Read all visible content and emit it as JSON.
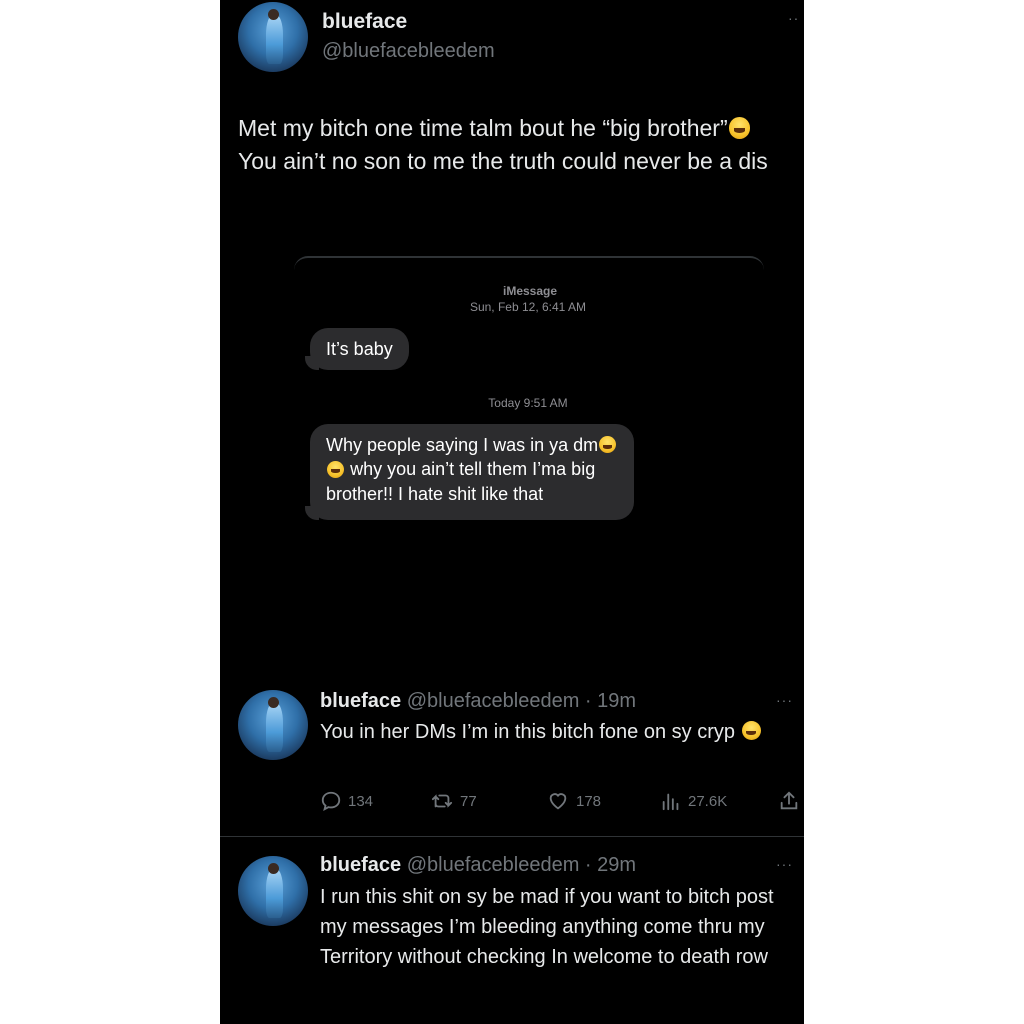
{
  "top_tweet": {
    "name": "blueface",
    "handle": "@bluefacebleedem",
    "text_part1": "Met my bitch one time talm bout he “big brother”",
    "text_part2": " You ain’t no son to me the truth could never be a dis"
  },
  "imessage": {
    "service": "iMessage",
    "date1": "Sun, Feb 12, 6:41 AM",
    "bubble1": "It’s baby",
    "date2": "Today 9:51 AM",
    "bubble2_part1": "Why people saying I was in ya dm",
    "bubble2_part2": " why you ain’t tell them I’ma big brother!! I hate shit like that"
  },
  "reply1": {
    "name": "blueface",
    "handle_time": "@bluefacebleedem · 19m",
    "text_part1": "You in her DMs I’m in this bitch fone on sy cryp ",
    "replies": "134",
    "retweets": "77",
    "likes": "178",
    "views": "27.6K"
  },
  "reply2": {
    "name": "blueface",
    "handle_time": "@bluefacebleedem · 29m",
    "text": "I run this shit on sy be mad if you want to bitch post my messages I’m bleeding anything come thru my Territory without checking In welcome to death row"
  },
  "colors": {
    "background": "#000000",
    "text": "#e7e9ea",
    "secondary": "#71767b",
    "bubble": "#2c2c2e"
  },
  "icons": [
    "more-dots-icon",
    "reply-icon",
    "retweet-icon",
    "like-icon",
    "views-icon",
    "share-icon",
    "laughing-emoji-icon"
  ]
}
